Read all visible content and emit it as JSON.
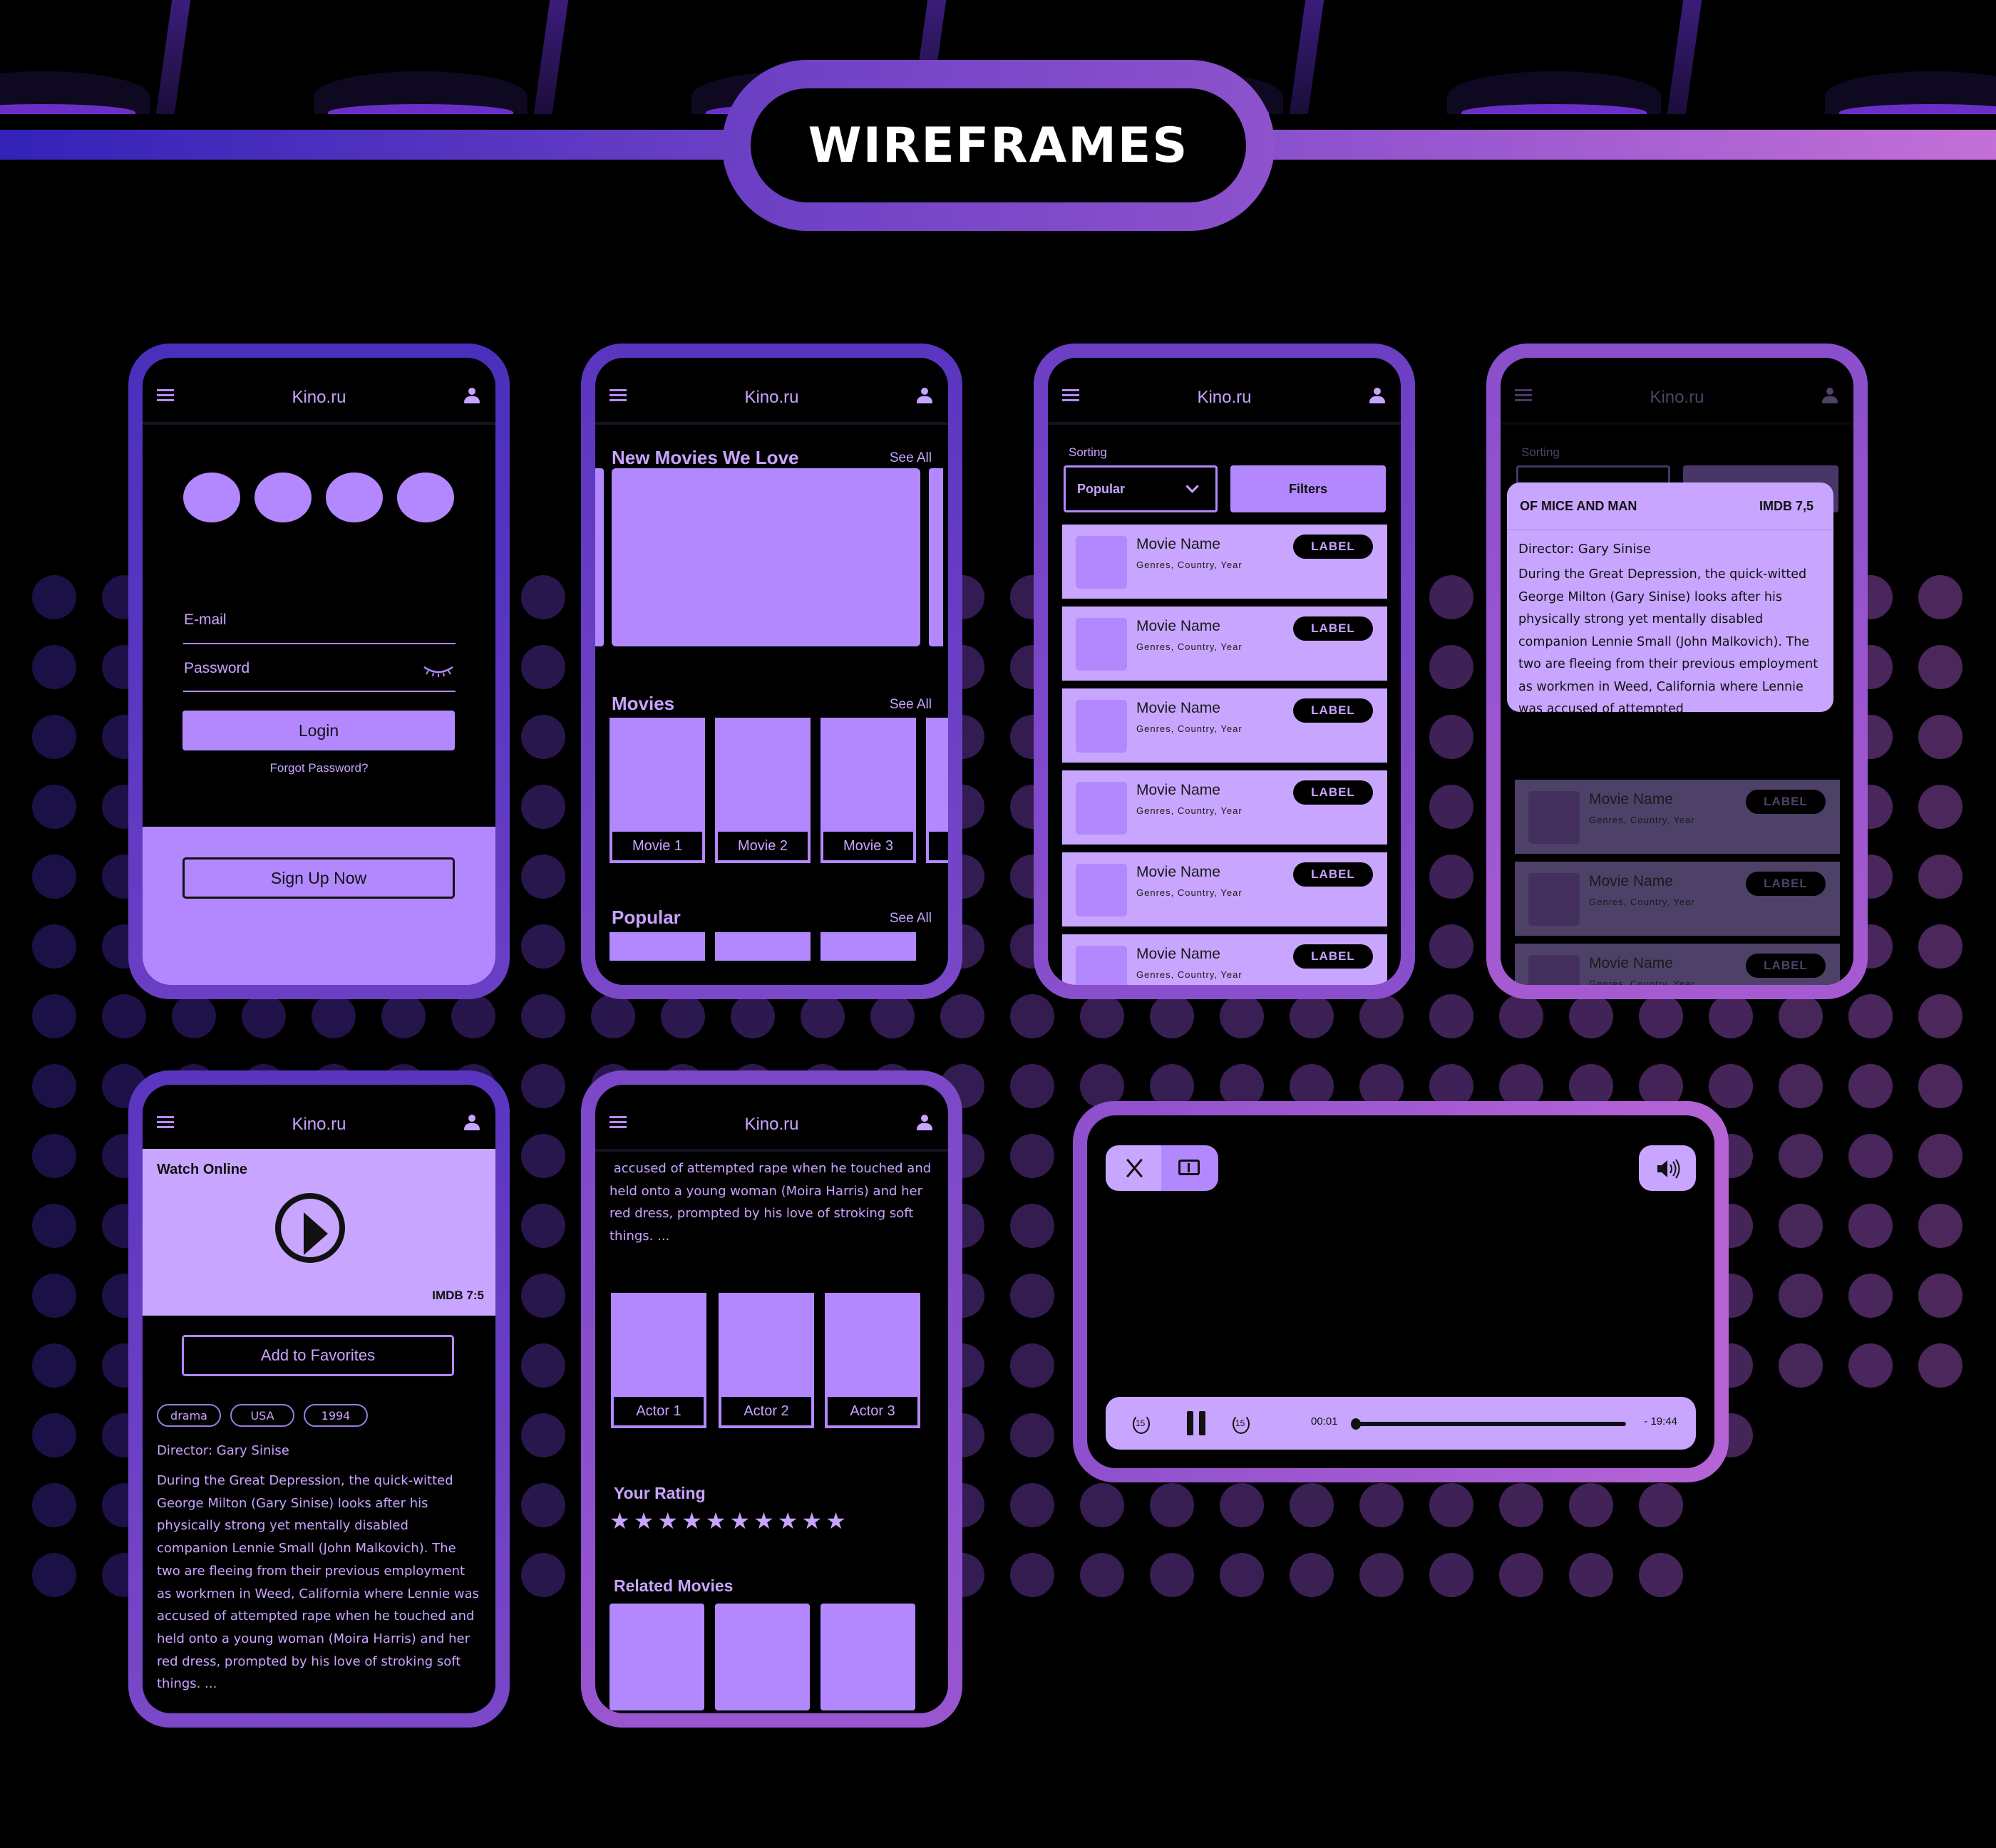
{
  "page": {
    "title": "WIREFRAMES",
    "colors": {
      "background": "#000000",
      "accent": "#b388ff",
      "accent_light": "#c8a6ff",
      "text_on_dark": "#c7a4ff",
      "frame_start": "#4a2fbc",
      "frame_end": "#b05fd6"
    }
  },
  "app": {
    "name": "Kino.ru",
    "menu_icon": "hamburger-menu-icon",
    "profile_icon": "user-icon"
  },
  "login_screen": {
    "email_placeholder": "E-mail",
    "password_placeholder": "Password",
    "password_toggle_icon": "closed-eye-icon",
    "login_button": "Login",
    "forgot_password": "Forgot Password?",
    "signup_button": "Sign Up Now",
    "social_buttons_count": 4
  },
  "home_screen": {
    "sections": [
      {
        "title": "New Movies We Love",
        "see_all": "See All"
      },
      {
        "title": "Movies",
        "see_all": "See All",
        "items": [
          "Movie 1",
          "Movie 2",
          "Movie 3"
        ]
      },
      {
        "title": "Popular",
        "see_all": "See All"
      }
    ]
  },
  "catalog_screen": {
    "sorting_label": "Sorting",
    "sort_value": "Popular",
    "filters_button": "Filters",
    "items": [
      {
        "name": "Movie Name",
        "meta": "Genres, Country, Year",
        "badge": "LABEL"
      },
      {
        "name": "Movie Name",
        "meta": "Genres, Country, Year",
        "badge": "LABEL"
      },
      {
        "name": "Movie Name",
        "meta": "Genres, Country, Year",
        "badge": "LABEL"
      },
      {
        "name": "Movie Name",
        "meta": "Genres, Country, Year",
        "badge": "LABEL"
      },
      {
        "name": "Movie Name",
        "meta": "Genres, Country, Year",
        "badge": "LABEL"
      },
      {
        "name": "Movie Name",
        "meta": "Genres, Country, Year",
        "badge": "LABEL"
      }
    ]
  },
  "preview_screen": {
    "title": "OF MICE AND MAN",
    "rating": "IMDB 7,5",
    "director": "Director: Gary Sinise",
    "description": "During the Great Depression, the quick-witted George Milton (Gary Sinise) looks after his physically strong yet mentally disabled companion Lennie Small (John Malkovich). The two are fleeing from their previous employment as workmen in Weed, California where Lennie was accused of attempted",
    "background_items": [
      {
        "name": "Movie Name",
        "meta": "Genres, Country, Year",
        "badge": "LABEL"
      },
      {
        "name": "Movie Name",
        "meta": "Genres, Country, Year",
        "badge": "LABEL"
      },
      {
        "name": "Movie Name",
        "meta": "Genres, Country, Year",
        "badge": "LABEL"
      }
    ]
  },
  "movie_screen": {
    "watch_online": "Watch Online",
    "play_icon": "play-circle-icon",
    "rating": "IMDB 7:5",
    "favorites_button": "Add to Favorites",
    "tags": [
      "drama",
      "USA",
      "1994"
    ],
    "director": "Director: Gary Sinise",
    "description": "During the Great Depression, the quick-witted George Milton (Gary Sinise) looks after his physically strong yet mentally disabled companion Lennie Small (John Malkovich). The two are fleeing from their previous employment as workmen in Weed, California where Lennie was accused of attempted rape when he touched and held onto a young woman (Moira Harris) and her red dress, prompted by his love of stroking soft things. ..."
  },
  "movie_screen_scrolled": {
    "description_tail": " accused of attempted rape when he touched and held onto a young woman (Moira Harris) and her red dress, prompted by his love of stroking soft things. ...",
    "actors": [
      "Actor 1",
      "Actor 2",
      "Actor 3"
    ],
    "rating_title": "Your Rating",
    "rating_stars_total": 10,
    "rating_stars_filled": 10,
    "related_title": "Related Movies",
    "related_count": 3
  },
  "player": {
    "close_icon": "close-icon",
    "fit_icon": "fit-screen-icon",
    "volume_icon": "volume-icon",
    "rewind_icon": "rewind-15-icon",
    "rewind_seconds": "15",
    "pause_icon": "pause-icon",
    "forward_icon": "forward-15-icon",
    "forward_seconds": "15",
    "elapsed": "00:01",
    "remaining": "- 19:44",
    "progress": 0.001
  }
}
